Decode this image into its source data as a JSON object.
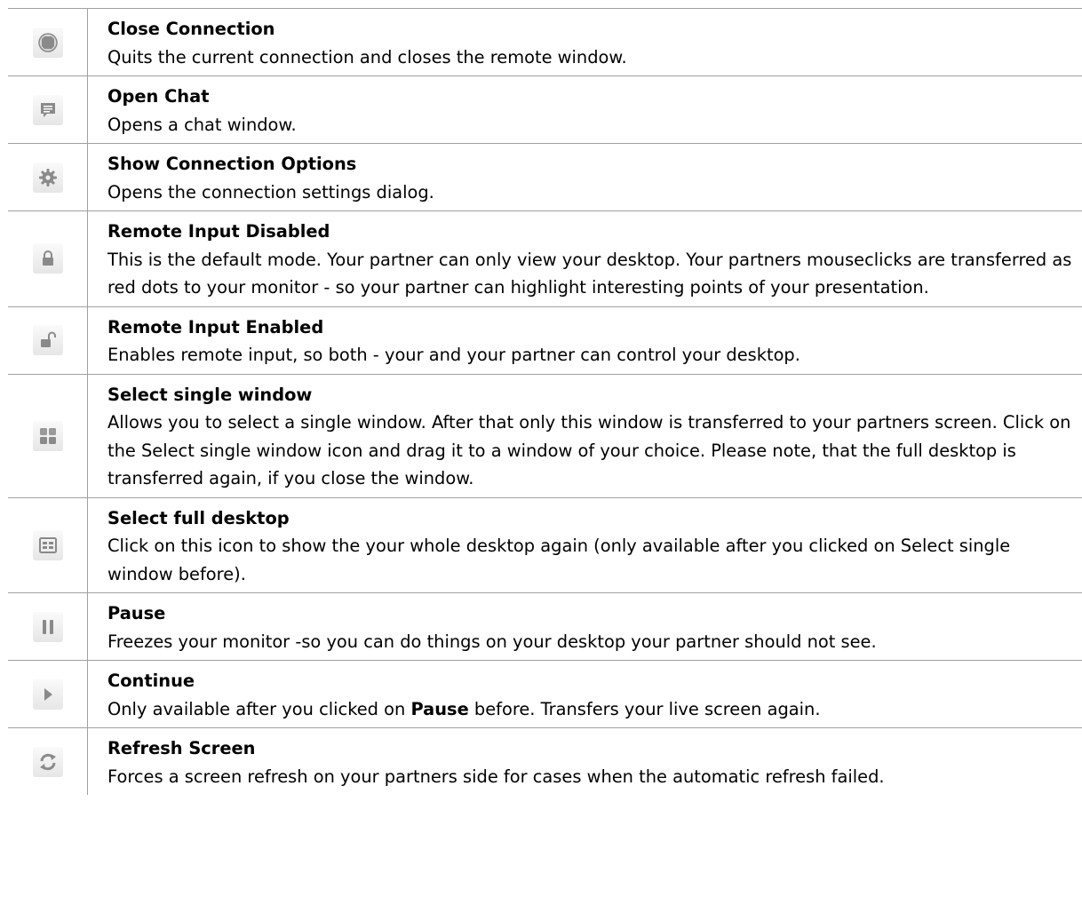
{
  "rows": [
    {
      "icon": "stop-octagon-icon",
      "title": "Close Connection",
      "desc": "Quits the current connection and closes the remote window."
    },
    {
      "icon": "chat-bubble-icon",
      "title": "Open Chat",
      "desc": "Opens a chat window."
    },
    {
      "icon": "gear-icon",
      "title": "Show Connection Options",
      "desc": "Opens the connection settings dialog."
    },
    {
      "icon": "lock-closed-icon",
      "title": "Remote Input Disabled",
      "desc": "This is the default mode. Your partner can only view your desktop. Your partners mouseclicks are transferred as red dots to your monitor - so your partner can highlight interesting points of your presentation."
    },
    {
      "icon": "lock-open-icon",
      "title": "Remote Input Enabled",
      "desc": "Enables remote input, so both - your and your partner can control your desktop."
    },
    {
      "icon": "four-squares-icon",
      "title": "Select single window",
      "desc": "Allows you to select a single window. After that only this window is transferred to your partners screen. Click on the Select single window icon and drag it to a window of your choice. Please note, that the full desktop is transferred again, if you close the window."
    },
    {
      "icon": "desktop-grid-icon",
      "title": "Select full desktop",
      "desc": "Click on this icon to show the your whole  desktop again (only available after you clicked on Select single window before)."
    },
    {
      "icon": "pause-icon",
      "title": "Pause",
      "desc": "Freezes your monitor -so you can do things on your desktop your partner should not see."
    },
    {
      "icon": "play-icon",
      "title": "Continue",
      "desc_pre": "Only available after you clicked on ",
      "desc_bold": "Pause",
      "desc_post": " before. Transfers your live screen again."
    },
    {
      "icon": "refresh-icon",
      "title": "Refresh Screen",
      "desc": "Forces a screen refresh on your partners side for cases when the automatic refresh failed."
    }
  ],
  "colors": {
    "border": "#a0a0a0",
    "icon_gray": "#8a8a8a"
  }
}
